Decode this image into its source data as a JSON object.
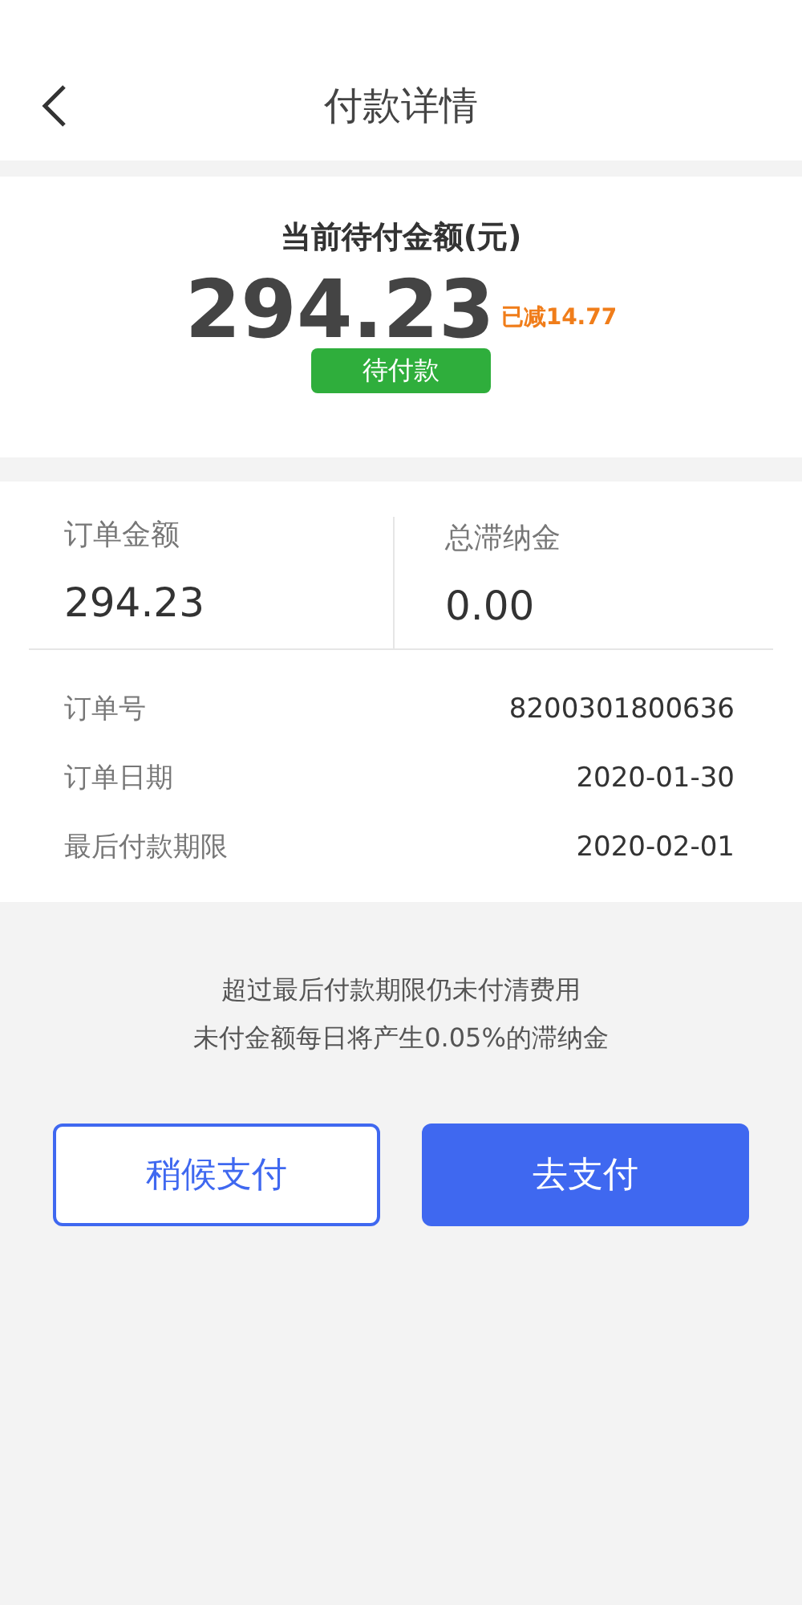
{
  "header": {
    "title": "付款详情"
  },
  "summary": {
    "label": "当前待付金额(元)",
    "amount": "294.23",
    "discount": "已减14.77",
    "status": "待付款"
  },
  "totals": [
    {
      "label": "订单金额",
      "value": "294.23"
    },
    {
      "label": "总滞纳金",
      "value": "0.00"
    }
  ],
  "details": [
    {
      "label": "订单号",
      "value": "8200301800636"
    },
    {
      "label": "订单日期",
      "value": "2020-01-30"
    },
    {
      "label": "最后付款期限",
      "value": "2020-02-01"
    }
  ],
  "notes": [
    "超过最后付款期限仍未付清费用",
    "未付金额每日将产生0.05%的滞纳金"
  ],
  "buttons": [
    {
      "label": "稍候支付",
      "kind": "outline"
    },
    {
      "label": "去支付",
      "kind": "primary"
    }
  ]
}
